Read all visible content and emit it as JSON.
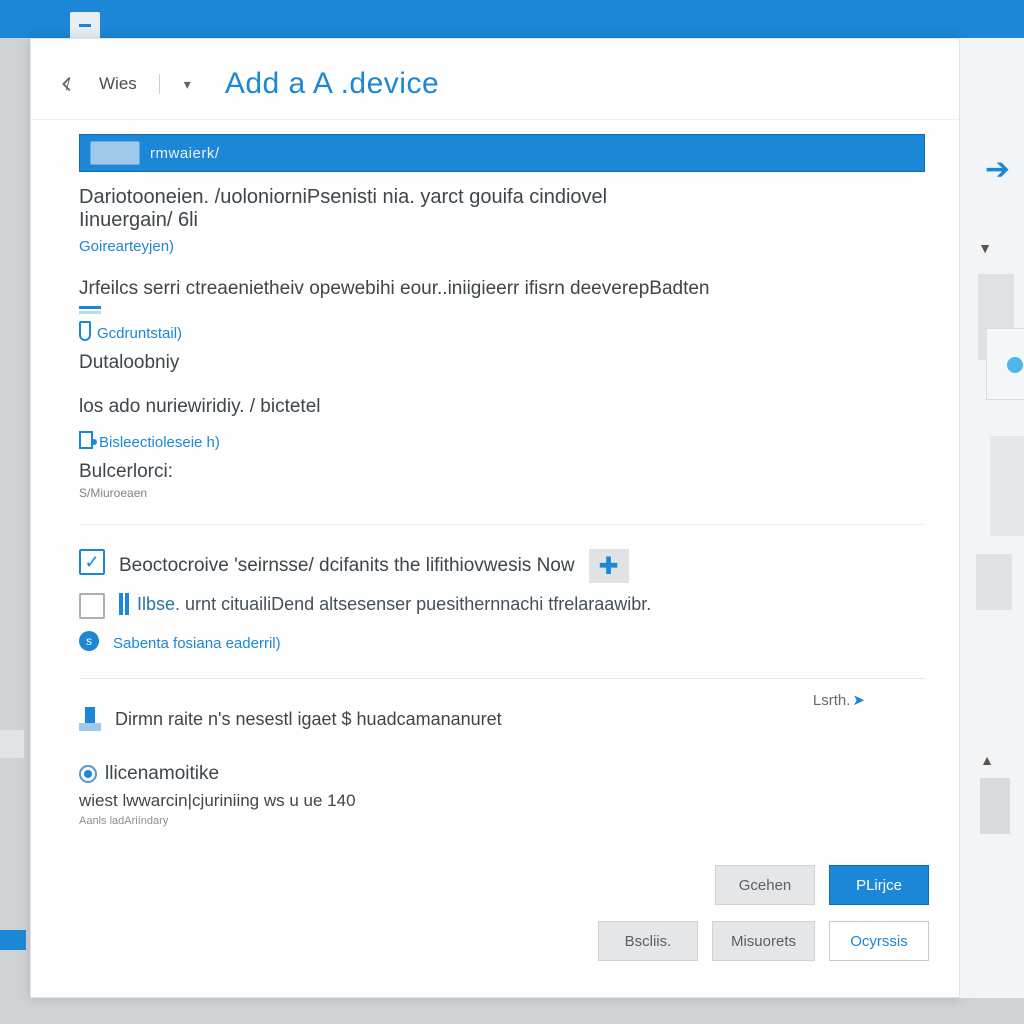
{
  "colors": {
    "accent": "#1c87d6"
  },
  "header": {
    "breadcrumb": "Wies",
    "title": "Add a A .device"
  },
  "search": {
    "value": "rmwaierk/"
  },
  "intro": {
    "line1": "Dariotooneien. /uoloniorniPsenisti nia. yarct gouifa cindiovel",
    "line2": "Iinuergain/ 6li",
    "link": "Goirearteyjen)"
  },
  "section1": {
    "title": "Jrfeilcs serri ctreaenietheiv opewebihi eour..iniigieerr ifisrn deeverepBadten",
    "link": "Gcdruntstail)",
    "item": "Dutaloobniy"
  },
  "section2": {
    "title": "los ado nuriewiridiy. / bictetel",
    "link": "Bisleectioleseie h)",
    "item": "Bulcerlorci:",
    "sub": "S/Miuroeaen"
  },
  "options": {
    "opt1": "Beoctocroive 'seirnsse/ dcifanits the lifithiovwesis Now",
    "opt2_prefix": "Ilbse.",
    "opt2_rest": "urnt cituailiDend altsesenser puesithernnachi tfrelaraawibr.",
    "link": "Sabenta fosiana eaderril)"
  },
  "footer_item": {
    "line": "Dirmn raite n's nesestl igaet $ huadcamananuret"
  },
  "radio_item": {
    "title": "llicenamoitike",
    "sub": "wiest lwwarcin|cjuriniing ws u ue 140",
    "note": "Aanls ladAriíndary"
  },
  "learn": "Lsrth.",
  "buttons": {
    "row1_a": "Gcehen",
    "row1_b": "PLirjce",
    "row2_a": "Bscliis.",
    "row2_b": "Misuorets",
    "row2_c": "Ocyrssis"
  }
}
